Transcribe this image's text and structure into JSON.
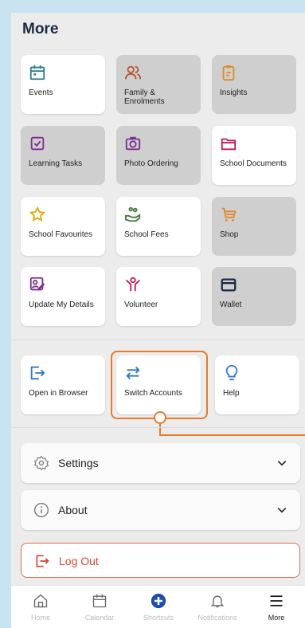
{
  "page": {
    "title": "More"
  },
  "tiles": [
    {
      "label": "Events",
      "icon": "calendar-icon"
    },
    {
      "label": "Family & Enrolments",
      "icon": "people-icon"
    },
    {
      "label": "Insights",
      "icon": "clipboard-icon"
    },
    {
      "label": "Learning Tasks",
      "icon": "checkbox-icon"
    },
    {
      "label": "Photo Ordering",
      "icon": "camera-icon"
    },
    {
      "label": "School Documents",
      "icon": "folder-icon"
    },
    {
      "label": "School Favourites",
      "icon": "star-icon"
    },
    {
      "label": "School Fees",
      "icon": "money-hand-icon"
    },
    {
      "label": "Shop",
      "icon": "cart-icon"
    },
    {
      "label": "Update My Details",
      "icon": "edit-profile-icon"
    },
    {
      "label": "Volunteer",
      "icon": "volunteer-icon"
    },
    {
      "label": "Wallet",
      "icon": "wallet-icon"
    }
  ],
  "utility_tiles": [
    {
      "label": "Open in Browser",
      "icon": "open-browser-icon"
    },
    {
      "label": "Switch Accounts",
      "icon": "switch-arrows-icon"
    },
    {
      "label": "Help",
      "icon": "lightbulb-icon"
    }
  ],
  "accordions": [
    {
      "label": "Settings",
      "icon": "gear-icon"
    },
    {
      "label": "About",
      "icon": "info-icon"
    }
  ],
  "logout": {
    "label": "Log Out"
  },
  "navbar": [
    {
      "label": "Home",
      "icon": "home-icon"
    },
    {
      "label": "Calendar",
      "icon": "calendar-icon"
    },
    {
      "label": "Shortcuts",
      "icon": "plus-circle-icon"
    },
    {
      "label": "Notifications",
      "icon": "bell-icon"
    },
    {
      "label": "More",
      "icon": "menu-icon"
    }
  ],
  "colors": {
    "title": "#1d2a44",
    "teal": "#2e7d8a",
    "brown": "#b5572e",
    "orange": "#e08b2c",
    "purple": "#7b2d91",
    "magenta": "#c2185b",
    "yellow": "#e0a800",
    "green": "#3d7a3d",
    "blue": "#2f78c4",
    "navy": "#1d2a44",
    "highlight": "#e67c2a",
    "logout": "#d64530"
  }
}
